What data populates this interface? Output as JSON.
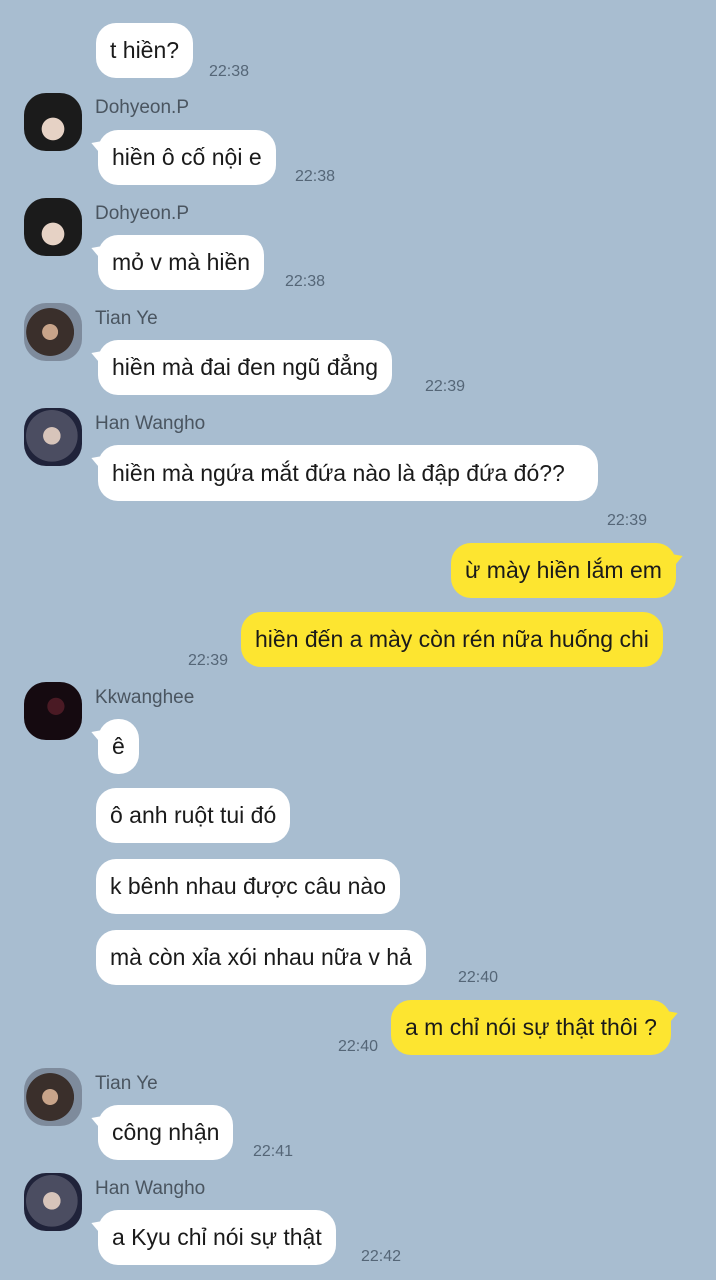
{
  "messages": {
    "m1": {
      "text": "t hiền?",
      "time": "22:38"
    },
    "m2": {
      "sender": "Dohyeon.P",
      "text": "hiền ô cố nội e",
      "time": "22:38"
    },
    "m3": {
      "sender": "Dohyeon.P",
      "text": "mỏ v mà hiền",
      "time": "22:38"
    },
    "m4": {
      "sender": "Tian Ye",
      "text": "hiền mà đai đen ngũ đẳng",
      "time": "22:39"
    },
    "m5": {
      "sender": "Han Wangho",
      "text": "hiền mà ngứa mắt đứa nào là đập đứa đó??",
      "time": "22:39"
    },
    "m6": {
      "text": "ừ mày hiền lắm em"
    },
    "m7": {
      "text": "hiền đến a mày còn rén nữa huống chi",
      "time": "22:39"
    },
    "m8": {
      "sender": "Kkwanghee",
      "text": "ê"
    },
    "m9": {
      "text": "ô anh ruột tui đó"
    },
    "m10": {
      "text": "k bênh nhau được câu nào"
    },
    "m11": {
      "text": "mà còn xỉa xói nhau nữa v hả",
      "time": "22:40"
    },
    "m12": {
      "text": "a m chỉ nói sự thật thôi ?",
      "time": "22:40"
    },
    "m13": {
      "sender": "Tian Ye",
      "text": "công nhận",
      "time": "22:41"
    },
    "m14": {
      "sender": "Han Wangho",
      "text": "a Kyu chỉ nói sự thật",
      "time": "22:42"
    }
  },
  "colors": {
    "background": "#a8bdd0",
    "incoming_bubble": "#ffffff",
    "outgoing_bubble": "#fde530"
  }
}
